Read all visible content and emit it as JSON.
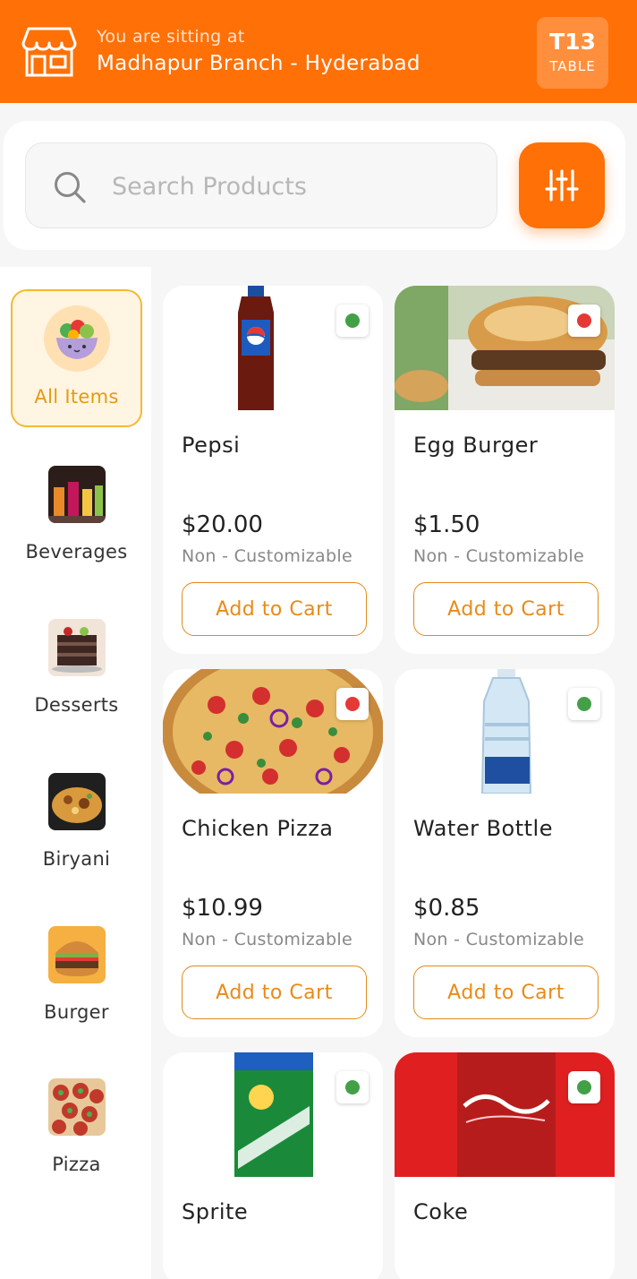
{
  "header": {
    "subtitle": "You are sitting at",
    "branch": "Madhapur Branch - Hyderabad",
    "table_code": "T13",
    "table_label": "TABLE",
    "background": "#ff7007",
    "store_icon": "storefront-icon"
  },
  "search": {
    "placeholder": "Search Products",
    "icon": "search-icon",
    "filter_icon": "sliders-icon"
  },
  "categories": [
    {
      "label": "All Items",
      "active": true,
      "icon": "salad-bowl"
    },
    {
      "label": "Beverages",
      "active": false,
      "icon": "drinks"
    },
    {
      "label": "Desserts",
      "active": false,
      "icon": "cake"
    },
    {
      "label": "Biryani",
      "active": false,
      "icon": "rice-dish"
    },
    {
      "label": "Burger",
      "active": false,
      "icon": "burger"
    },
    {
      "label": "Pizza",
      "active": false,
      "icon": "pizza"
    }
  ],
  "products": [
    {
      "name": "Pepsi",
      "price": "$20.00",
      "note": "Non - Customizable",
      "button": "Add to Cart",
      "veg": true
    },
    {
      "name": "Egg Burger",
      "price": "$1.50",
      "note": "Non - Customizable",
      "button": "Add to Cart",
      "veg": false
    },
    {
      "name": "Chicken Pizza",
      "price": "$10.99",
      "note": "Non - Customizable",
      "button": "Add to Cart",
      "veg": false
    },
    {
      "name": "Water Bottle",
      "price": "$0.85",
      "note": "Non - Customizable",
      "button": "Add to Cart",
      "veg": true
    },
    {
      "name": "Sprite",
      "veg": true
    },
    {
      "name": "Coke",
      "veg": true
    }
  ],
  "colors": {
    "accent": "#ff7007",
    "veg": "#43a047",
    "non_veg": "#e53935",
    "active_border": "#f3b935"
  }
}
